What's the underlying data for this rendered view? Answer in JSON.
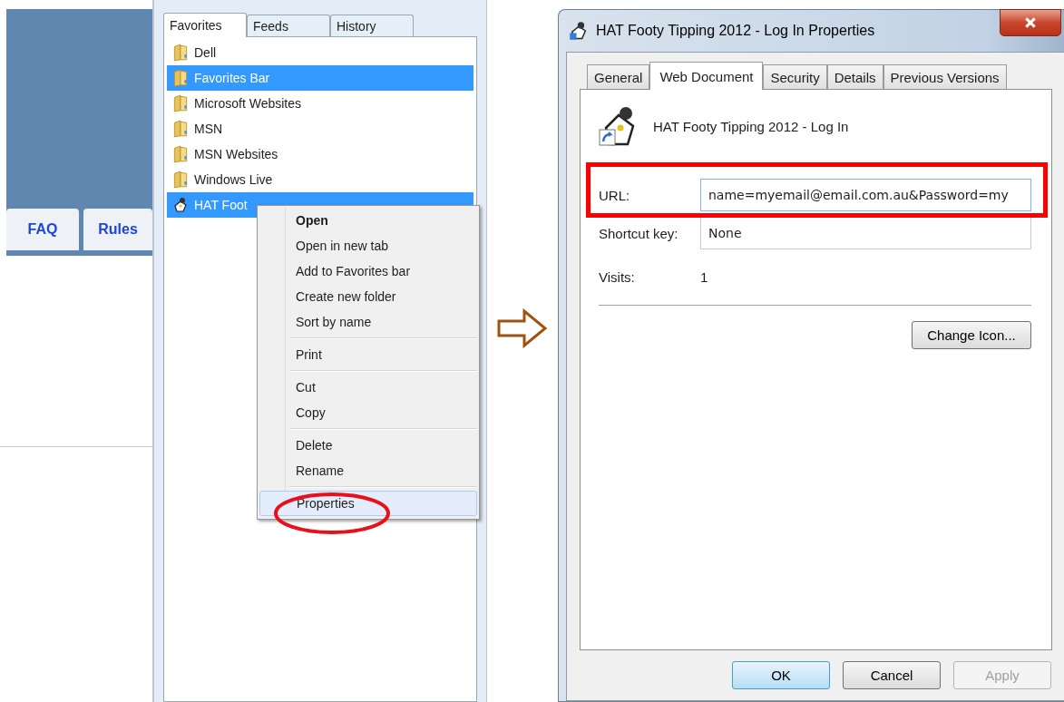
{
  "left_page": {
    "tabs": [
      {
        "label": "FAQ"
      },
      {
        "label": "Rules"
      }
    ]
  },
  "favorites_center": {
    "tabs": [
      {
        "label": "Favorites",
        "selected": true
      },
      {
        "label": "Feeds",
        "selected": false
      },
      {
        "label": "History",
        "selected": false
      }
    ],
    "items": [
      {
        "kind": "folder",
        "label": "Dell",
        "selected": false
      },
      {
        "kind": "folder",
        "label": "Favorites Bar",
        "selected": true
      },
      {
        "kind": "folder",
        "label": "Microsoft Websites",
        "selected": false
      },
      {
        "kind": "folder",
        "label": "MSN",
        "selected": false
      },
      {
        "kind": "folder",
        "label": "MSN Websites",
        "selected": false
      },
      {
        "kind": "folder",
        "label": "Windows Live",
        "selected": false
      },
      {
        "kind": "shortcut",
        "label": "HAT Foot",
        "selected": true
      }
    ]
  },
  "context_menu": {
    "groups": [
      [
        {
          "label": "Open",
          "default": true,
          "selected": false
        },
        {
          "label": "Open in new tab",
          "default": false,
          "selected": false
        },
        {
          "label": "Add to Favorites bar",
          "default": false,
          "selected": false
        },
        {
          "label": "Create new folder",
          "default": false,
          "selected": false
        },
        {
          "label": "Sort by name",
          "default": false,
          "selected": false
        }
      ],
      [
        {
          "label": "Print",
          "default": false,
          "selected": false
        }
      ],
      [
        {
          "label": "Cut",
          "default": false,
          "selected": false
        },
        {
          "label": "Copy",
          "default": false,
          "selected": false
        }
      ],
      [
        {
          "label": "Delete",
          "default": false,
          "selected": false
        },
        {
          "label": "Rename",
          "default": false,
          "selected": false
        }
      ],
      [
        {
          "label": "Properties",
          "default": false,
          "selected": true
        }
      ]
    ]
  },
  "dialog": {
    "title": "HAT Footy Tipping 2012 - Log In Properties",
    "tabs": [
      {
        "label": "General",
        "selected": false
      },
      {
        "label": "Web Document",
        "selected": true
      },
      {
        "label": "Security",
        "selected": false
      },
      {
        "label": "Details",
        "selected": false
      },
      {
        "label": "Previous Versions",
        "selected": false
      }
    ],
    "shortcut_name": "HAT Footy Tipping 2012 - Log In",
    "fields": [
      {
        "label": "URL:",
        "value": "name=myemail@email.com.au&Password=my",
        "focused": true
      },
      {
        "label": "Shortcut key:",
        "value": "None",
        "focused": false
      }
    ],
    "visits": {
      "label": "Visits:",
      "value": "1"
    },
    "change_icon_button": "Change Icon...",
    "buttons": [
      {
        "label": "OK",
        "kind": "default"
      },
      {
        "label": "Cancel",
        "kind": "normal"
      },
      {
        "label": "Apply",
        "kind": "disabled"
      }
    ]
  }
}
